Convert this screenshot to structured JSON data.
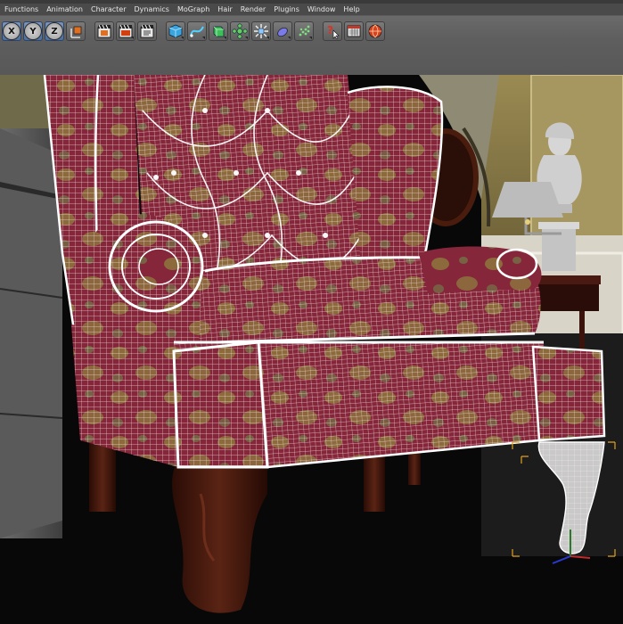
{
  "menu": {
    "items": [
      "Functions",
      "Animation",
      "Character",
      "Dynamics",
      "MoGraph",
      "Hair",
      "Render",
      "Plugins",
      "Window",
      "Help"
    ]
  },
  "toolbar": {
    "axis_labels": [
      "X",
      "Y",
      "Z"
    ],
    "icons": [
      "coordinate-system-icon",
      "render-view-icon",
      "render-picture-viewer-icon",
      "render-settings-icon",
      "cube-primitive-icon",
      "spline-pen-icon",
      "nurbs-extrude-icon",
      "array-cloner-icon",
      "deformer-icon",
      "environment-sky-icon",
      "particle-emitter-icon",
      "help-pointer-icon",
      "calendar-tag-icon",
      "web-globe-icon"
    ]
  },
  "colors": {
    "menubar_bg": "#4a4a4a",
    "toolbar_bg": "#5e5e5e",
    "fabric_red": "#8a2a3c",
    "fabric_gold": "#8a7a3a",
    "wood": "#4a1c10",
    "wall_gold": "#8a7840",
    "wire": "#ffffff"
  }
}
